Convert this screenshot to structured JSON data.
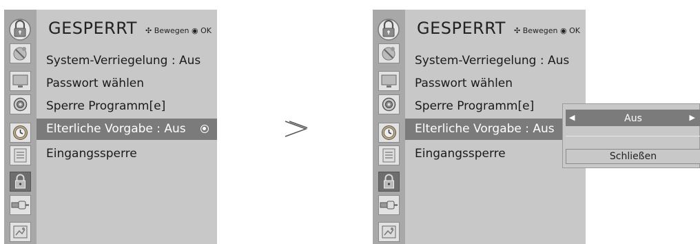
{
  "left_menu": {
    "title": "GESPERRT",
    "hint_move": "Bewegen",
    "hint_ok": "OK",
    "items": [
      {
        "label": "System-Verriegelung : Aus"
      },
      {
        "label": "Passwort wählen"
      },
      {
        "label": "Sperre Programm[e]"
      },
      {
        "label": "Elterliche Vorgabe  : Aus"
      },
      {
        "label": "Eingangssperre"
      }
    ],
    "selected_index": 3
  },
  "right_menu": {
    "title": "GESPERRT",
    "hint_move": "Bewegen",
    "hint_ok": "OK",
    "items": [
      {
        "label": "System-Verriegelung : Aus"
      },
      {
        "label": "Passwort wählen"
      },
      {
        "label": "Sperre Programm[e]"
      },
      {
        "label": "Elterliche Vorgabe  : Aus"
      },
      {
        "label": "Eingangssperre"
      }
    ],
    "selected_index": 3
  },
  "popup": {
    "value": "Aus",
    "close_label": "Schließen"
  },
  "icons": [
    "antenna-icon",
    "picture-icon",
    "audio-icon",
    "clock-icon",
    "option-icon",
    "lock-icon",
    "input-icon",
    "usb-icon"
  ],
  "colors": {
    "panel": "#c8c8c8",
    "icon_strip": "#a8a8a8",
    "selection": "#7b7b7b"
  }
}
